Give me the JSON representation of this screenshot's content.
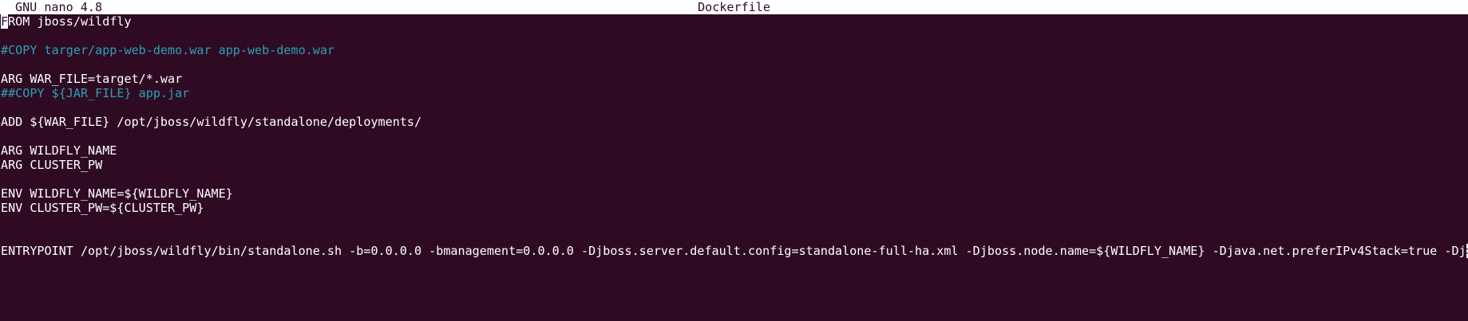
{
  "titlebar": {
    "app": "GNU nano 4.8",
    "filename": "Dockerfile"
  },
  "colors": {
    "background": "#2f0b23",
    "text": "#ffffff",
    "comment": "#2aa1b3"
  },
  "editor": {
    "cursor_char": "F",
    "overflow_marker": ">",
    "lines": [
      {
        "text": "ROM jboss/wildfly",
        "type": "code"
      },
      {
        "text": "",
        "type": "code"
      },
      {
        "text": "#COPY targer/app-web-demo.war app-web-demo.war",
        "type": "comment"
      },
      {
        "text": "",
        "type": "code"
      },
      {
        "text": "ARG WAR_FILE=target/*.war",
        "type": "code"
      },
      {
        "text": "##COPY ${JAR_FILE} app.jar",
        "type": "comment"
      },
      {
        "text": "",
        "type": "code"
      },
      {
        "text": "ADD ${WAR_FILE} /opt/jboss/wildfly/standalone/deployments/",
        "type": "code"
      },
      {
        "text": "",
        "type": "code"
      },
      {
        "text": "ARG WILDFLY_NAME",
        "type": "code"
      },
      {
        "text": "ARG CLUSTER_PW",
        "type": "code"
      },
      {
        "text": "",
        "type": "code"
      },
      {
        "text": "ENV WILDFLY_NAME=${WILDFLY_NAME}",
        "type": "code"
      },
      {
        "text": "ENV CLUSTER_PW=${CLUSTER_PW}",
        "type": "code"
      },
      {
        "text": "",
        "type": "code"
      },
      {
        "text": "",
        "type": "code"
      },
      {
        "text": "ENTRYPOINT /opt/jboss/wildfly/bin/standalone.sh -b=0.0.0.0 -bmanagement=0.0.0.0 -Djboss.server.default.config=standalone-full-ha.xml -Djboss.node.name=${WILDFLY_NAME} -Djava.net.preferIPv4Stack=true -Dj",
        "type": "code"
      }
    ]
  }
}
